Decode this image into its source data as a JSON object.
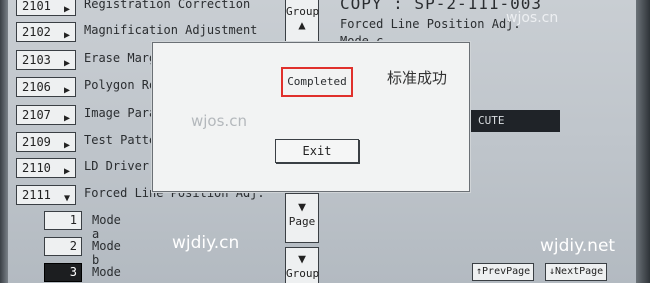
{
  "list": [
    {
      "code": "2101",
      "label": "Registration Correction",
      "expanded": false
    },
    {
      "code": "2102",
      "label": "Magnification Adjustment",
      "expanded": false
    },
    {
      "code": "2103",
      "label": "Erase Margi",
      "expanded": false
    },
    {
      "code": "2106",
      "label": "Polygon Rot",
      "expanded": false
    },
    {
      "code": "2107",
      "label": "Image Param",
      "expanded": false
    },
    {
      "code": "2109",
      "label": "Test Patter",
      "expanded": false
    },
    {
      "code": "2110",
      "label": "LD Driver",
      "expanded": false
    },
    {
      "code": "2111",
      "label": "Forced Line Position Adj.",
      "expanded": true
    }
  ],
  "modes": [
    {
      "num": "1",
      "label": "Mode a",
      "selected": false
    },
    {
      "num": "2",
      "label": "Mode b",
      "selected": false
    },
    {
      "num": "3",
      "label": "Mode c",
      "selected": true
    }
  ],
  "side_buttons": {
    "group_top": "Group",
    "page": "Page",
    "group_bottom": "Group"
  },
  "right_panel": {
    "title": "COPY : SP-2-111-003",
    "subtitle": "Forced Line Position Adj.",
    "mode_line": "Mode c",
    "bar_text": "CUTE"
  },
  "nav": {
    "prev": "PrevPage",
    "next": "NextPage"
  },
  "dialog": {
    "message": "Completed",
    "annotation": "标准成功",
    "exit_label": "Exit"
  },
  "watermarks": {
    "top_right": "wjos.cn",
    "dialog": "wjos.cn",
    "bottom_left": "wjdiy.cn",
    "bottom_right": "wjdiy.net"
  },
  "colors": {
    "highlight_border": "#e0302b"
  }
}
